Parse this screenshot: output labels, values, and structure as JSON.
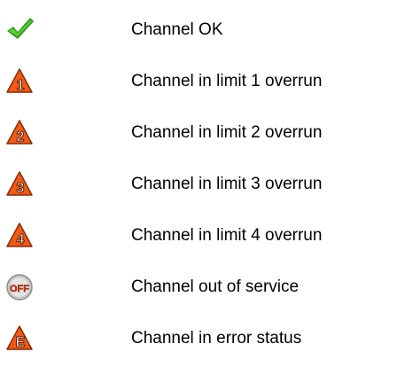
{
  "legend": {
    "items": [
      {
        "icon": "checkmark-icon",
        "label": "Channel OK"
      },
      {
        "icon": "limit-1-warning-icon",
        "badge": "1",
        "label": "Channel in limit 1 overrun"
      },
      {
        "icon": "limit-2-warning-icon",
        "badge": "2",
        "label": "Channel in limit 2 overrun"
      },
      {
        "icon": "limit-3-warning-icon",
        "badge": "3",
        "label": "Channel in limit 3 overrun"
      },
      {
        "icon": "limit-4-warning-icon",
        "badge": "4",
        "label": "Channel in limit 4 overrun"
      },
      {
        "icon": "off-icon",
        "badge": "OFF",
        "label": "Channel out of service"
      },
      {
        "icon": "error-warning-icon",
        "badge": "E",
        "label": "Channel in error status"
      }
    ]
  },
  "colors": {
    "ok_green": "#33b01e",
    "warning_orange": "#f05a14",
    "badge_text": "#ffffff",
    "off_disc": "#c8c8c8",
    "off_text": "#e83a0f"
  }
}
